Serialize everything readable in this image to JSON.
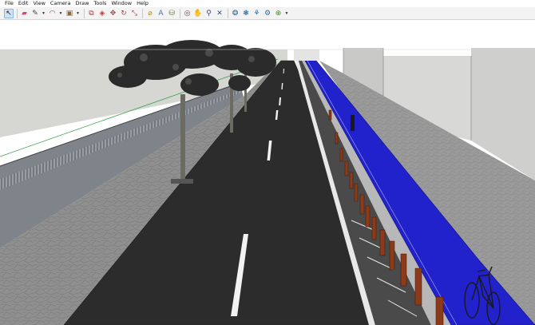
{
  "menu": [
    "File",
    "Edit",
    "View",
    "Camera",
    "Draw",
    "Tools",
    "Window",
    "Help"
  ],
  "toolbar": {
    "tools": [
      {
        "name": "select-tool-icon",
        "glyph": "↖",
        "color": "#1a1a1a",
        "selected": true
      },
      {
        "name": "eraser-tool-icon",
        "glyph": "▰",
        "color": "#d6467a"
      },
      {
        "name": "line-tool-icon",
        "glyph": "✎",
        "color": "#444444",
        "dropdown": true
      },
      {
        "name": "arc-tool-icon",
        "glyph": "◠",
        "color": "#cc3344",
        "dropdown": true
      },
      {
        "name": "shape-tool-icon",
        "glyph": "▣",
        "color": "#8a6a3a",
        "dropdown": true
      },
      {
        "name": "push-pull-tool-icon",
        "glyph": "⧉",
        "color": "#b0323a"
      },
      {
        "name": "follow-me-tool-icon",
        "glyph": "◈",
        "color": "#c0392b"
      },
      {
        "name": "move-tool-icon",
        "glyph": "✥",
        "color": "#c0392b"
      },
      {
        "name": "rotate-tool-icon",
        "glyph": "↻",
        "color": "#c0392b"
      },
      {
        "name": "scale-tool-icon",
        "glyph": "⤡",
        "color": "#c0392b"
      },
      {
        "name": "tape-measure-tool-icon",
        "glyph": "⌀",
        "color": "#b8860b"
      },
      {
        "name": "text-tool-icon",
        "glyph": "A",
        "color": "#4a6fa5"
      },
      {
        "name": "paint-bucket-tool-icon",
        "glyph": "⛁",
        "color": "#5a7a3a"
      },
      {
        "name": "orbit-tool-icon",
        "glyph": "◎",
        "color": "#b03030"
      },
      {
        "name": "pan-tool-icon",
        "glyph": "✋",
        "color": "#b05a30"
      },
      {
        "name": "zoom-tool-icon",
        "glyph": "⚲",
        "color": "#2a4a8a"
      },
      {
        "name": "zoom-extents-tool-icon",
        "glyph": "✕",
        "color": "#2a4a8a"
      },
      {
        "name": "3d-warehouse-icon",
        "glyph": "❂",
        "color": "#2a6a9a"
      },
      {
        "name": "extension-warehouse-icon",
        "glyph": "❃",
        "color": "#2a6a9a"
      },
      {
        "name": "share-model-icon",
        "glyph": "⚘",
        "color": "#2a6a9a"
      },
      {
        "name": "layout-icon",
        "glyph": "⚙",
        "color": "#2a6a9a"
      },
      {
        "name": "extension-manager-icon",
        "glyph": "⊕",
        "color": "#4a8a3a",
        "dropdown": true
      }
    ]
  },
  "scene": {
    "colors": {
      "sky": "#ffffff",
      "road": "#2b2b2b",
      "sidewalk": "#8a8a8a",
      "bike_lane": "#2323c8",
      "wall": "#8a8d92",
      "building": "#d2d2d0",
      "bollard": "#8b3a1a",
      "tree": "#2a2a2a"
    }
  }
}
